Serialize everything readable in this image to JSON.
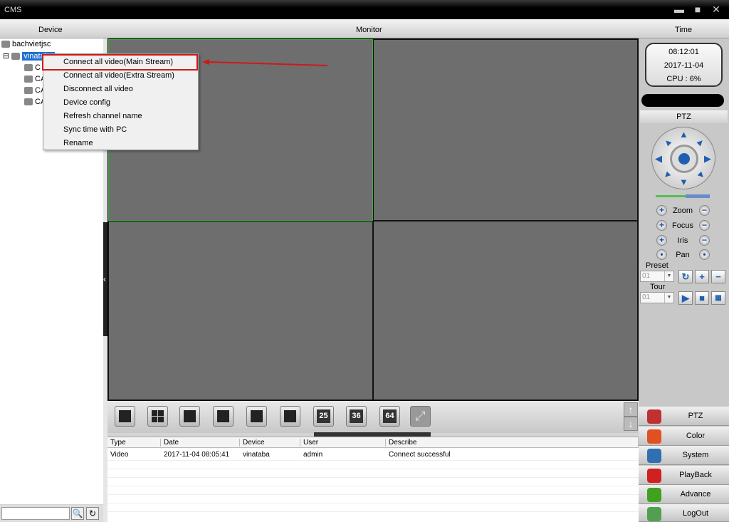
{
  "window": {
    "title": "CMS",
    "min": "▬",
    "max": "■",
    "close": "✕"
  },
  "header": {
    "device": "Device",
    "monitor": "Monitor",
    "time": "Time"
  },
  "tree": {
    "root": "bachvietjsc",
    "device": "vinataba",
    "channels": [
      "C",
      "CA",
      "CA",
      "CA"
    ],
    "expand": "⊟"
  },
  "context_menu": {
    "items": [
      "Connect all video(Main Stream)",
      "Connect all video(Extra Stream)",
      "Disconnect all video",
      "Device config",
      "Refresh channel name",
      "Sync time with PC",
      "Rename"
    ],
    "highlighted": 0,
    "highlight_color": "#d01818"
  },
  "search": {
    "value": "",
    "search_icon": "🔍",
    "refresh_icon": "↻"
  },
  "layout_buttons": [
    "1",
    "4",
    "6",
    "9",
    "8",
    "16",
    "25",
    "36",
    "64",
    "fullscreen"
  ],
  "scroll": {
    "up": "↑",
    "down": "↓"
  },
  "log": {
    "columns": [
      "Type",
      "Date",
      "Device",
      "User",
      "Describe"
    ],
    "rows": [
      [
        "Video",
        "2017-11-04 08:05:41",
        "vinataba",
        "admin",
        "Connect successful"
      ]
    ]
  },
  "clock": {
    "time": "08:12:01",
    "date": "2017-11-04",
    "cpu": "CPU : 6%"
  },
  "ptz": {
    "title": "PTZ",
    "controls": [
      {
        "label": "Zoom",
        "plus": "+",
        "minus": "−"
      },
      {
        "label": "Focus",
        "plus": "+",
        "minus": "−"
      },
      {
        "label": "Iris",
        "plus": "+",
        "minus": "−"
      },
      {
        "label": "Pan",
        "plus": "•",
        "minus": "•"
      }
    ],
    "speed_percent": 55,
    "preset_label": "Preset",
    "preset_value": "01",
    "tour_label": "Tour",
    "tour_value": "01"
  },
  "nav": [
    {
      "label": "PTZ",
      "color": "#c03030"
    },
    {
      "label": "Color",
      "color": "#e05020"
    },
    {
      "label": "System",
      "color": "#3070b0"
    },
    {
      "label": "PlayBack",
      "color": "#d02020"
    },
    {
      "label": "Advance",
      "color": "#40a020"
    },
    {
      "label": "LogOut",
      "color": "#50a050"
    }
  ]
}
